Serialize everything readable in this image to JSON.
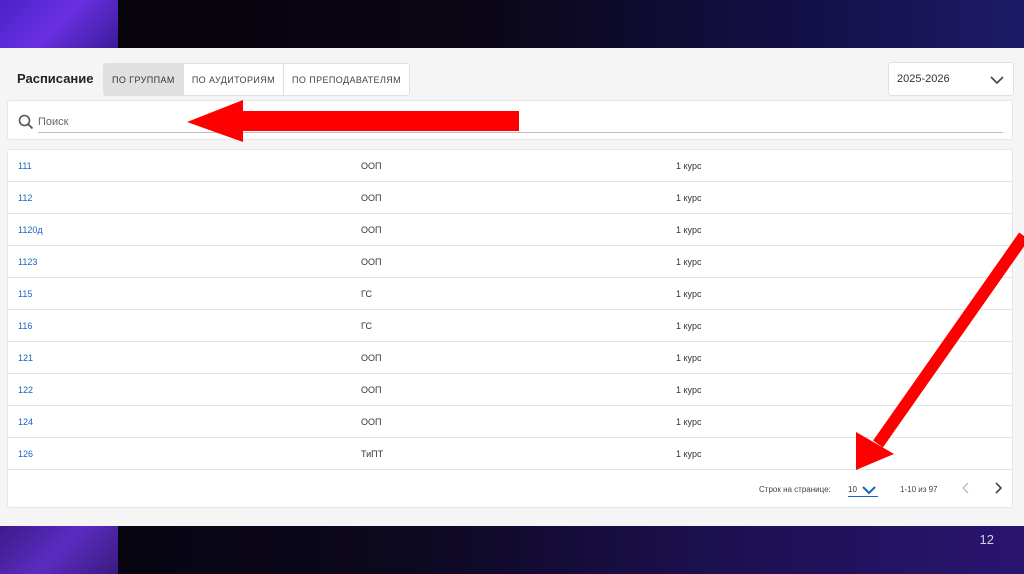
{
  "header": {
    "title": "Расписание",
    "tabs": [
      {
        "label": "ПО ГРУППАМ",
        "active": true
      },
      {
        "label": "ПО АУДИТОРИЯМ",
        "active": false
      },
      {
        "label": "ПО ПРЕПОДАВАТЕЛЯМ",
        "active": false
      }
    ],
    "year": "2025-2026"
  },
  "search": {
    "placeholder": "Поиск",
    "value": ""
  },
  "table": {
    "rows": [
      {
        "group": "111",
        "type": "ООП",
        "course": "1 курс"
      },
      {
        "group": "112",
        "type": "ООП",
        "course": "1 курс"
      },
      {
        "group": "1120д",
        "type": "ООП",
        "course": "1 курс"
      },
      {
        "group": "1123",
        "type": "ООП",
        "course": "1 курс"
      },
      {
        "group": "115",
        "type": "ГС",
        "course": "1 курс"
      },
      {
        "group": "116",
        "type": "ГС",
        "course": "1 курс"
      },
      {
        "group": "121",
        "type": "ООП",
        "course": "1 курс"
      },
      {
        "group": "122",
        "type": "ООП",
        "course": "1 курс"
      },
      {
        "group": "124",
        "type": "ООП",
        "course": "1 курс"
      },
      {
        "group": "126",
        "type": "ТиПТ",
        "course": "1 курс"
      }
    ]
  },
  "pagination": {
    "rows_per_page_label": "Строк на странице:",
    "rows_per_page": "10",
    "range": "1-10 из 97"
  },
  "slide": {
    "number": "12"
  },
  "colors": {
    "link": "#1565c0",
    "arrow": "#ff0000",
    "banner_accent": "#5b2cc0"
  },
  "icons": {
    "search": "search-icon",
    "chevron": "chevron-down-icon",
    "prev": "chevron-left-icon",
    "next": "chevron-right-icon"
  }
}
